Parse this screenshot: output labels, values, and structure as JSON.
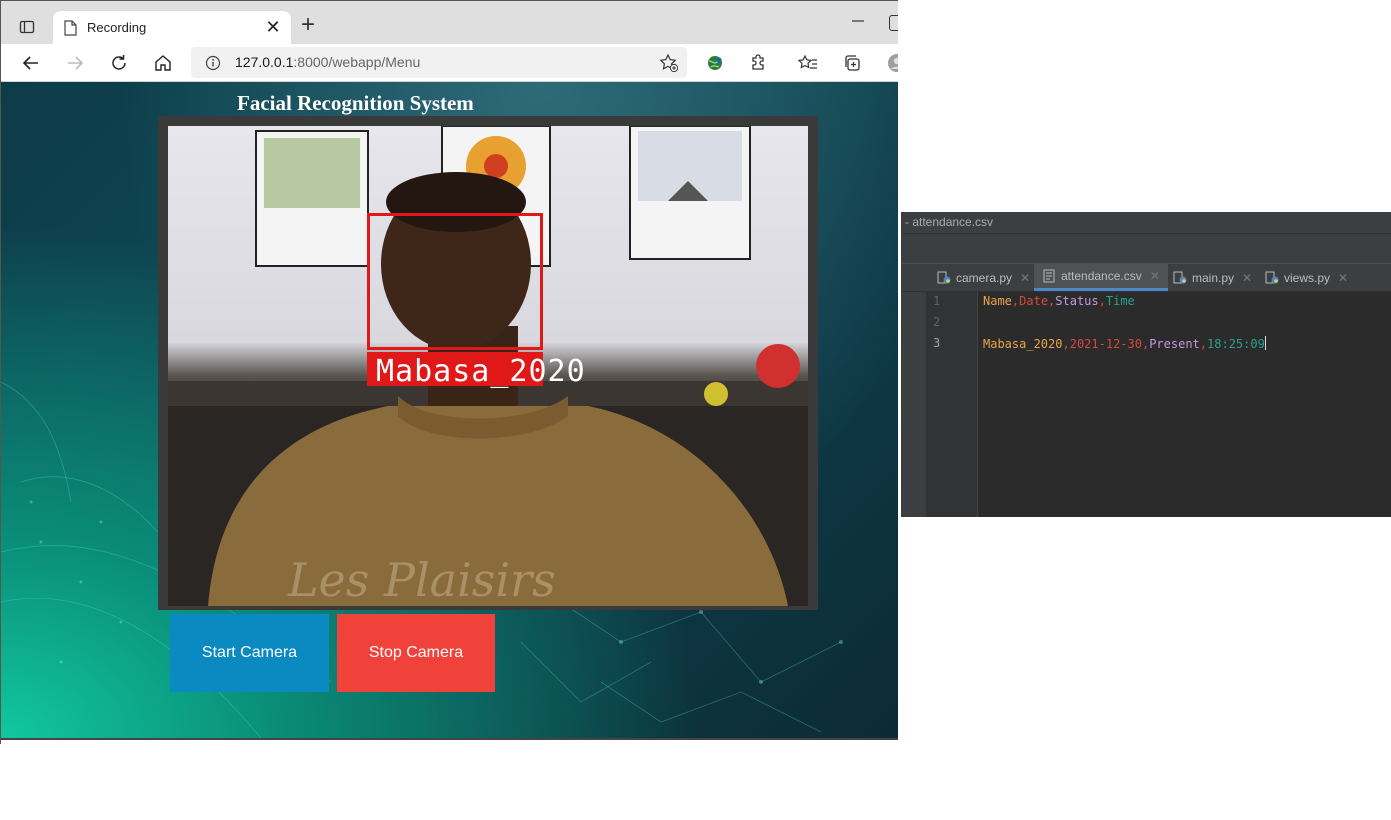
{
  "browser": {
    "tab_title": "Recording",
    "tab_close": "✕",
    "new_tab": "+",
    "url_host": "127.0.0.1",
    "url_path": ":8000/webapp/Menu"
  },
  "page": {
    "title": "Facial Recognition System",
    "recognized_name": "Mabasa_2020",
    "buttons": {
      "start": "Start Camera",
      "stop": "Stop Camera"
    },
    "colors": {
      "start": "#0a8ac0",
      "stop": "#f0423a",
      "face_box": "#e01818"
    }
  },
  "ide": {
    "window_title": "- attendance.csv",
    "tabs": [
      {
        "label": "camera.py",
        "icon": "python-file-icon",
        "active": false
      },
      {
        "label": "attendance.csv",
        "icon": "text-file-icon",
        "active": true
      },
      {
        "label": "main.py",
        "icon": "python-file-icon",
        "active": false
      },
      {
        "label": "views.py",
        "icon": "python-file-icon",
        "active": false
      }
    ],
    "tab_close": "✕",
    "line_numbers": [
      "1",
      "2",
      "3"
    ],
    "lines": [
      {
        "c1": "Name",
        "c2": "Date",
        "c3": "Status",
        "c4": "Time"
      },
      {
        "c1": "",
        "c2": "",
        "c3": "",
        "c4": ""
      },
      {
        "c1": "Mabasa_2020",
        "c2": "2021-12-30",
        "c3": "Present",
        "c4": "18:25:09"
      }
    ],
    "separator": ",",
    "colors": {
      "col1": "#e8a54a",
      "col2": "#d8483c",
      "col3": "#c995e0",
      "col4": "#29a08c"
    }
  }
}
